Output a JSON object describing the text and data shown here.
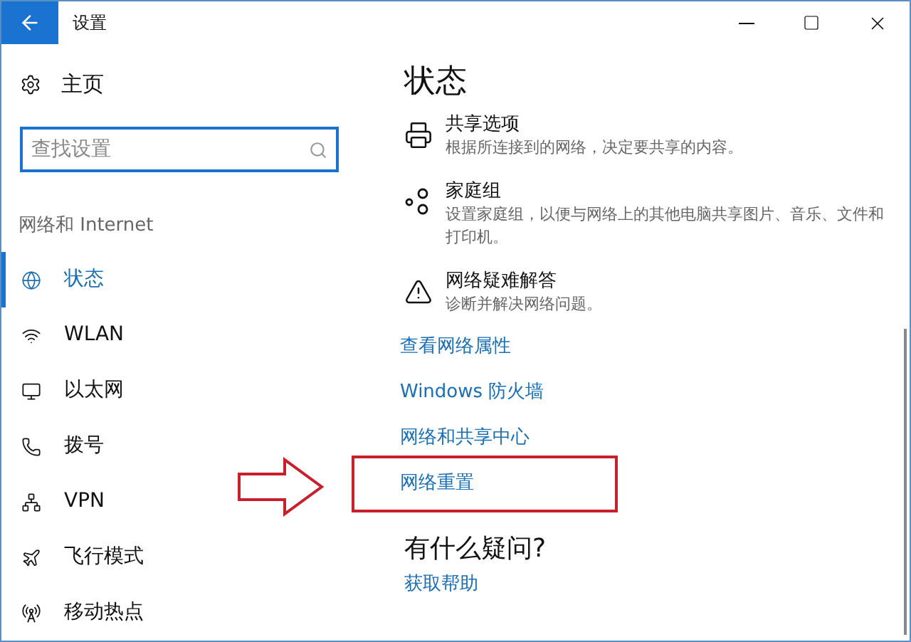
{
  "window": {
    "title": "设置"
  },
  "sidebar": {
    "home": "主页",
    "search": {
      "placeholder": "查找设置"
    },
    "section": "网络和 Internet",
    "items": [
      {
        "label": "状态",
        "kind": "status",
        "selected": true
      },
      {
        "label": "WLAN",
        "kind": "wifi",
        "selected": false
      },
      {
        "label": "以太网",
        "kind": "ethernet",
        "selected": false
      },
      {
        "label": "拨号",
        "kind": "dialup",
        "selected": false
      },
      {
        "label": "VPN",
        "kind": "vpn",
        "selected": false
      },
      {
        "label": "飞行模式",
        "kind": "airplane",
        "selected": false
      },
      {
        "label": "移动热点",
        "kind": "hotspot",
        "selected": false
      }
    ]
  },
  "main": {
    "title": "状态",
    "options": [
      {
        "kind": "sharing",
        "title": "共享选项",
        "description": "根据所连接到的网络，决定要共享的内容。"
      },
      {
        "kind": "homegroup",
        "title": "家庭组",
        "description": "设置家庭组，以便与网络上的其他电脑共享图片、音乐、文件和打印机。"
      },
      {
        "kind": "troubleshoot",
        "title": "网络疑难解答",
        "description": "诊断并解决网络问题。"
      }
    ],
    "links": [
      {
        "label": "查看网络属性",
        "highlighted": false
      },
      {
        "label": "Windows 防火墙",
        "highlighted": false
      },
      {
        "label": "网络和共享中心",
        "highlighted": false
      },
      {
        "label": "网络重置",
        "highlighted": true
      }
    ],
    "help": {
      "title": "有什么疑问?",
      "link": "获取帮助"
    }
  }
}
